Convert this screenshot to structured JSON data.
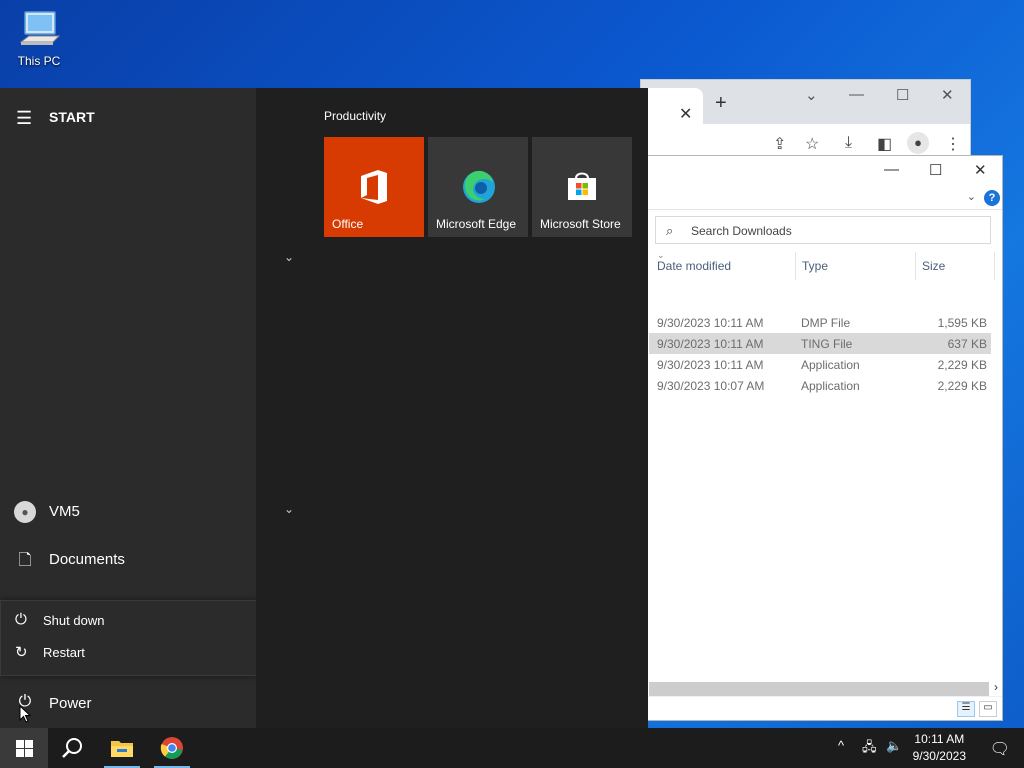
{
  "desktop": {
    "this_pc_label": "This PC"
  },
  "chrome": {
    "tab_close": "✕",
    "new_tab": "+",
    "controls": {
      "dropdown": "⌄",
      "minimize": "—",
      "maximize": "☐",
      "close": "✕"
    }
  },
  "explorer": {
    "controls": {
      "minimize": "—",
      "maximize": "☐",
      "close": "✕"
    },
    "help": "?",
    "search_placeholder": "Search Downloads",
    "columns": {
      "date": "Date modified",
      "type": "Type",
      "size": "Size"
    },
    "rows": [
      {
        "date": "9/30/2023 10:11 AM",
        "type": "DMP File",
        "size": "1,595 KB",
        "selected": false
      },
      {
        "date": "9/30/2023 10:11 AM",
        "type": "TING File",
        "size": "637 KB",
        "selected": true
      },
      {
        "date": "9/30/2023 10:11 AM",
        "type": "Application",
        "size": "2,229 KB",
        "selected": false
      },
      {
        "date": "9/30/2023 10:07 AM",
        "type": "Application",
        "size": "2,229 KB",
        "selected": false
      }
    ]
  },
  "start_menu": {
    "title": "START",
    "user": "VM5",
    "documents": "Documents",
    "power_options": {
      "shut_down": "Shut down",
      "restart": "Restart"
    },
    "power": "Power",
    "group_title": "Productivity",
    "tiles": [
      {
        "label": "Office",
        "color": "#d83b01"
      },
      {
        "label": "Microsoft Edge",
        "color": "#383838"
      },
      {
        "label": "Microsoft Store",
        "color": "#383838"
      }
    ]
  },
  "taskbar": {
    "time": "10:11 AM",
    "date": "9/30/2023",
    "pinned": [
      "windows-start-icon",
      "search-icon",
      "file-explorer-icon",
      "chrome-icon"
    ]
  }
}
